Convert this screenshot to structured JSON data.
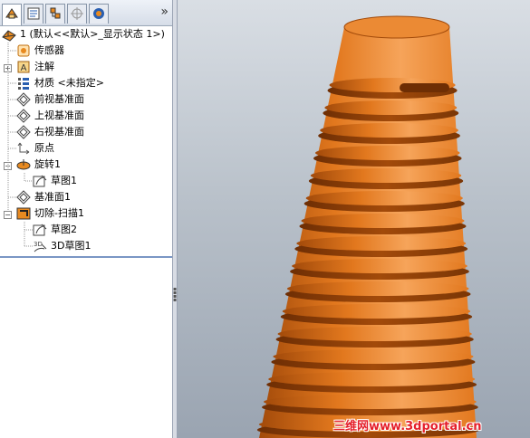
{
  "tabs": [
    {
      "name": "featuremanager",
      "active": true
    },
    {
      "name": "propertymanager",
      "active": false
    },
    {
      "name": "configurationmanager",
      "active": false
    },
    {
      "name": "dimxpert",
      "active": false
    },
    {
      "name": "display-manager",
      "active": false
    }
  ],
  "tab_more": "»",
  "tree": {
    "root": {
      "label": "1  (默认<<默认>_显示状态 1>)",
      "icon": "part-icon"
    },
    "items": [
      {
        "label": "传感器",
        "icon": "sensor-icon"
      },
      {
        "label": "注解",
        "icon": "annotation-icon",
        "expandable": true
      },
      {
        "label": "材质 <未指定>",
        "icon": "material-icon"
      },
      {
        "label": "前视基准面",
        "icon": "plane-icon"
      },
      {
        "label": "上视基准面",
        "icon": "plane-icon"
      },
      {
        "label": "右视基准面",
        "icon": "plane-icon"
      },
      {
        "label": "原点",
        "icon": "origin-icon"
      },
      {
        "label": "旋转1",
        "icon": "revolve-icon",
        "expandable": true,
        "children": [
          {
            "label": "草图1",
            "icon": "sketch-icon"
          }
        ]
      },
      {
        "label": "基准面1",
        "icon": "plane-icon"
      },
      {
        "label": "切除-扫描1",
        "icon": "cut-sweep-icon",
        "expandable": true,
        "children": [
          {
            "label": "草图2",
            "icon": "sketch-icon"
          },
          {
            "label": "3D草图1",
            "icon": "3d-sketch-icon"
          }
        ]
      }
    ]
  },
  "model": {
    "color": "#e2781e",
    "shadow": "#a24a0a",
    "highlight": "#f6a45a"
  },
  "watermark": "三维网www.3dportal.cn"
}
